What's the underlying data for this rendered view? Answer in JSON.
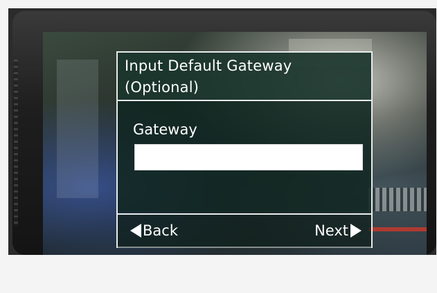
{
  "dialog": {
    "title_line1": "Input Default Gateway",
    "title_line2": "(Optional)",
    "field_label": "Gateway",
    "field_value": "",
    "back_label": "Back",
    "next_label": "Next"
  },
  "icons": {
    "back": "triangle-left-icon",
    "next": "triangle-right-icon"
  },
  "colors": {
    "header_bg": "#1c3830",
    "body_bg": "#102822",
    "border": "#e8ecec",
    "text": "#ffffff"
  }
}
